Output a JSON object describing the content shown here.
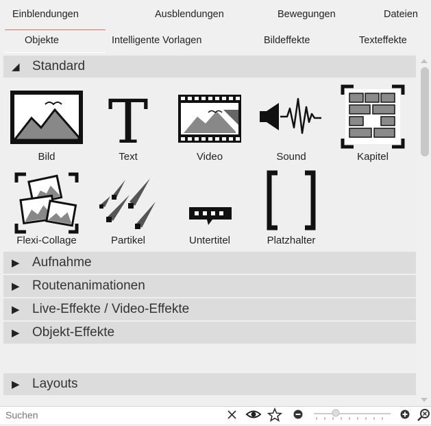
{
  "tabs_row1": [
    "Einblendungen",
    "Ausblendungen",
    "Bewegungen",
    "Dateien"
  ],
  "tabs_row2": [
    "Objekte",
    "Intelligente Vorlagen",
    "Bildeffekte",
    "Texteffekte"
  ],
  "active_tab": "Objekte",
  "sections": {
    "standard": {
      "title": "Standard",
      "items": [
        "Bild",
        "Text",
        "Video",
        "Sound",
        "Kapitel",
        "Flexi-Collage",
        "Partikel",
        "Untertitel",
        "Platzhalter"
      ]
    },
    "collapsed": [
      "Aufnahme",
      "Routenanimationen",
      "Live-Effekte / Video-Effekte",
      "Objekt-Effekte",
      "Layouts"
    ]
  },
  "search": {
    "placeholder": "Suchen"
  },
  "colors": {
    "active_tab_accent": "#e86a6a",
    "section_header": "#dcdcdc",
    "panel_bg": "#efefef"
  }
}
